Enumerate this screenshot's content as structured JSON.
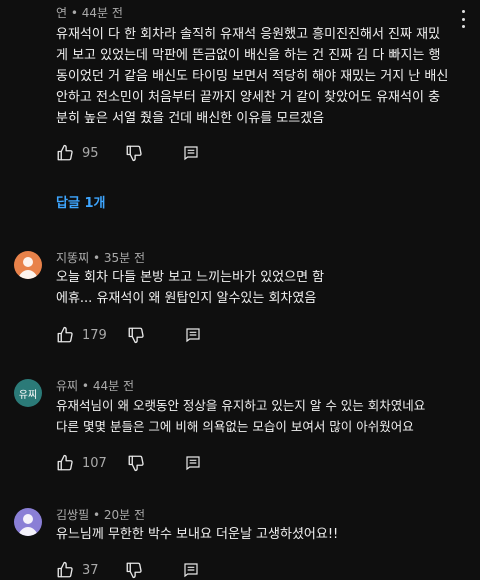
{
  "colors": {
    "bg": "#0f0f0f",
    "text": "#f1f1f1",
    "muted": "#aaaaaa",
    "link": "#3ea6ff"
  },
  "comments": [
    {
      "author": "연",
      "time": "44분 전",
      "text": "유재석이 다 한 회차라 솔직히 유재석 응원했고 흥미진진해서 진짜 재밌게 보고 있었는데 막판에 뜬금없이 배신을 하는 건 진짜 김 다 빠지는 행동이었던 거 같음 배신도 타이밍 보면서 적당히 해야 재밌는 거지 난 배신 안하고 전소민이 처음부터 끝까지 양세찬 거 같이 찾았어도 유재석이 충분히 높은 서열 줬을 건데 배신한 이유를 모르겠음",
      "likes": "95",
      "replies": "답글 1개"
    },
    {
      "author": "지똥찌",
      "time": "35분 전",
      "text": "오늘 회차 다들 본방 보고 느끼는바가 있었으면 함\n에휴... 유재석이 왜 원탑인지 알수있는 회차였음",
      "likes": "179",
      "avatar_color": "#e8824a"
    },
    {
      "author": "유찌",
      "time": "44분 전",
      "text": "유재석님이 왜 오랫동안 정상을 유지하고 있는지 알 수 있는 회차였네요\n다른 몇몇 분들은 그에 비해 의욕없는 모습이 보여서 많이 아쉬웠어요",
      "likes": "107",
      "avatar_label": "유찌",
      "avatar_color": "#2b7a78"
    },
    {
      "author": "김쌍필",
      "time": "20분 전",
      "text": "유느님께 무한한 박수 보내요 더운날 고생하셨어요!!",
      "likes": "37",
      "avatar_color": "#8a7fd6"
    }
  ]
}
